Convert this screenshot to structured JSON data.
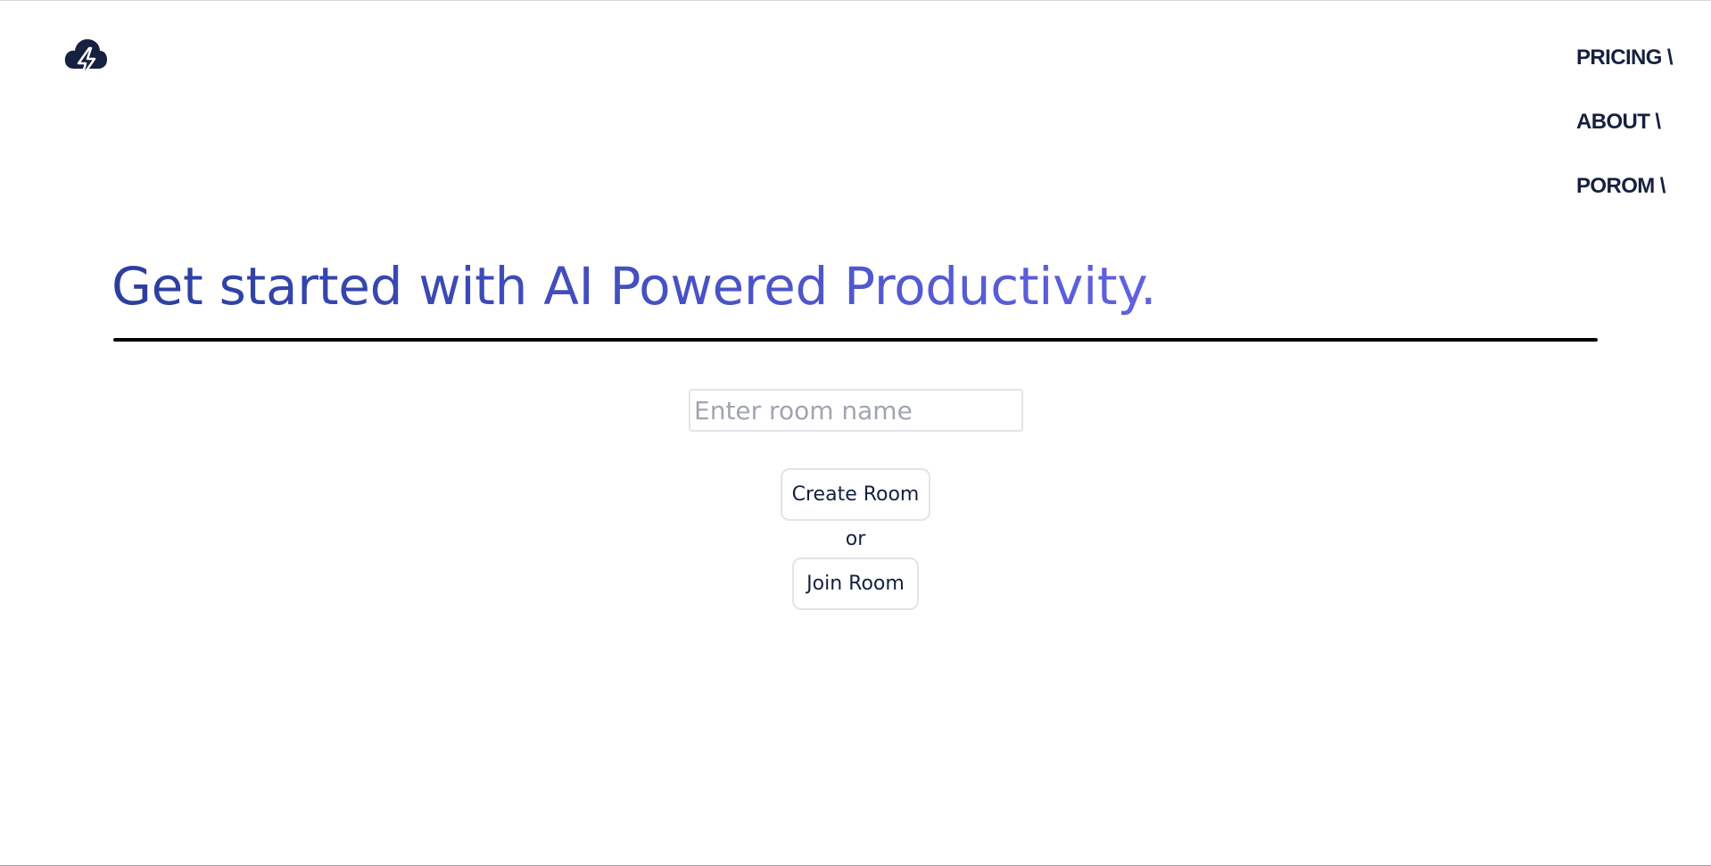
{
  "header": {
    "logo_icon": "cloud-lightning-icon",
    "nav": {
      "pricing_label": "PRICING \\",
      "about_label": "ABOUT \\",
      "porom_label": "POROM \\"
    }
  },
  "hero": {
    "title": "Get started with AI Powered Productivity."
  },
  "room": {
    "input_value": "",
    "input_placeholder": "Enter room name",
    "create_label": "Create Room",
    "or_label": "or",
    "join_label": "Join Room"
  },
  "colors": {
    "brand_dark": "#15213f",
    "title_gradient_start": "#2b3e9e",
    "title_gradient_end": "#6262df",
    "divider": "#000000",
    "border": "#e4e4e7",
    "placeholder": "#a1a5b1"
  }
}
